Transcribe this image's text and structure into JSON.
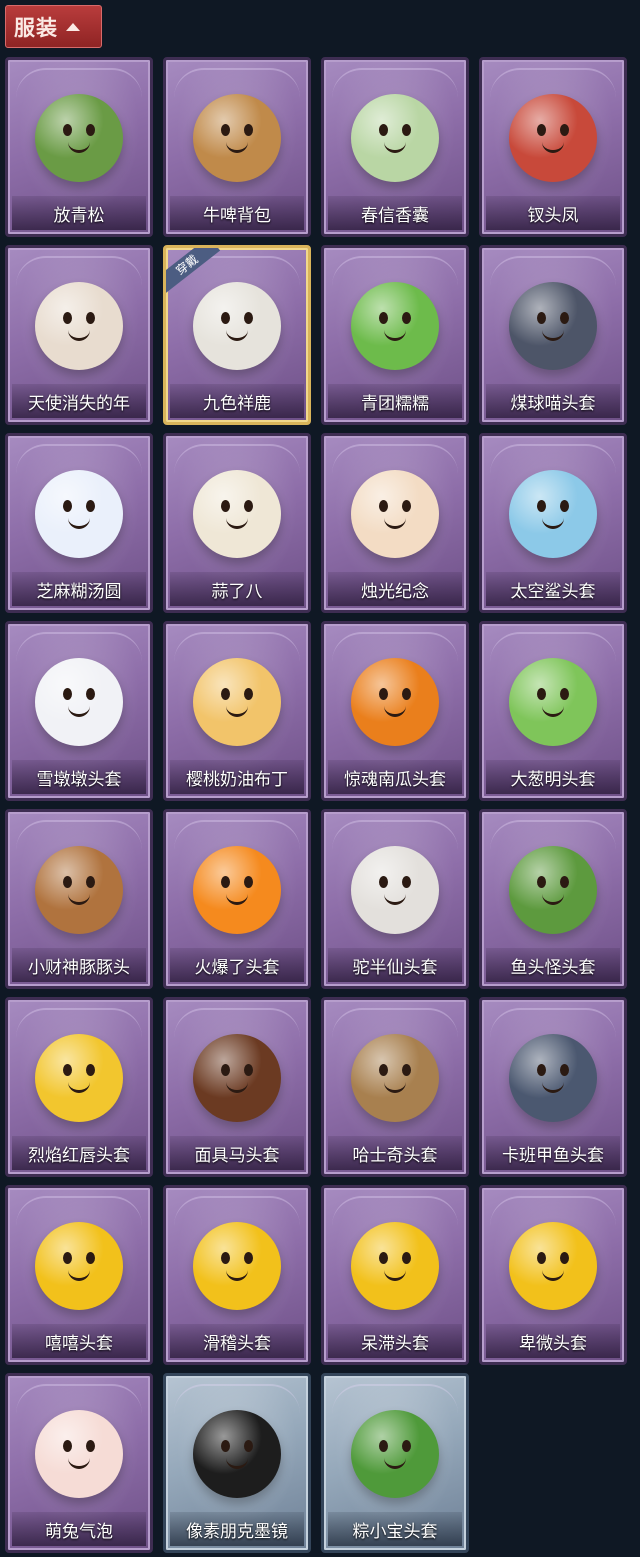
{
  "header": {
    "title": "服装"
  },
  "items": [
    {
      "label": "放青松",
      "color": "#6a9b45",
      "style": "purple"
    },
    {
      "label": "牛啤背包",
      "color": "#c08a4a",
      "style": "purple"
    },
    {
      "label": "春信香囊",
      "color": "#b9d6a4",
      "style": "purple"
    },
    {
      "label": "钗头凤",
      "color": "#c8493a",
      "style": "purple"
    },
    {
      "label": "天使消失的年",
      "color": "#e8dccf",
      "style": "purple"
    },
    {
      "label": "九色祥鹿",
      "color": "#e6e3dc",
      "style": "purple",
      "badge": "穿戴"
    },
    {
      "label": "青团糯糯",
      "color": "#6dbb4b",
      "style": "purple"
    },
    {
      "label": "煤球喵头套",
      "color": "#4d5568",
      "style": "purple"
    },
    {
      "label": "芝麻糊汤圆",
      "color": "#eaf0fb",
      "style": "purple"
    },
    {
      "label": "蒜了八",
      "color": "#efe7d6",
      "style": "purple"
    },
    {
      "label": "烛光纪念",
      "color": "#f3dcc4",
      "style": "purple"
    },
    {
      "label": "太空鲨头套",
      "color": "#8cc9e8",
      "style": "purple"
    },
    {
      "label": "雪墩墩头套",
      "color": "#f1f2f6",
      "style": "purple"
    },
    {
      "label": "樱桃奶油布丁",
      "color": "#f2c46a",
      "style": "purple"
    },
    {
      "label": "惊魂南瓜头套",
      "color": "#ea7f1c",
      "style": "purple"
    },
    {
      "label": "大葱明头套",
      "color": "#7fc55a",
      "style": "purple"
    },
    {
      "label": "小财神豚豚头",
      "color": "#b0733e",
      "style": "purple"
    },
    {
      "label": "火爆了头套",
      "color": "#f58a1e",
      "style": "purple"
    },
    {
      "label": "驼半仙头套",
      "color": "#e3e0dc",
      "style": "purple"
    },
    {
      "label": "鱼头怪头套",
      "color": "#5d9a3e",
      "style": "purple"
    },
    {
      "label": "烈焰红唇头套",
      "color": "#f2c62e",
      "style": "purple"
    },
    {
      "label": "面具马头套",
      "color": "#6b3a22",
      "style": "purple"
    },
    {
      "label": "哈士奇头套",
      "color": "#a8804f",
      "style": "purple"
    },
    {
      "label": "卡班甲鱼头套",
      "color": "#4b5870",
      "style": "purple"
    },
    {
      "label": "嘻嘻头套",
      "color": "#f2c11b",
      "style": "purple"
    },
    {
      "label": "滑稽头套",
      "color": "#f2c11b",
      "style": "purple"
    },
    {
      "label": "呆滞头套",
      "color": "#f2c11b",
      "style": "purple"
    },
    {
      "label": "卑微头套",
      "color": "#f2c11b",
      "style": "purple"
    },
    {
      "label": "萌兔气泡",
      "color": "#f6dcd6",
      "style": "purple"
    },
    {
      "label": "像素朋克墨镜",
      "color": "#1d1d1d",
      "style": "blue"
    },
    {
      "label": "粽小宝头套",
      "color": "#4f9a3a",
      "style": "blue"
    }
  ]
}
